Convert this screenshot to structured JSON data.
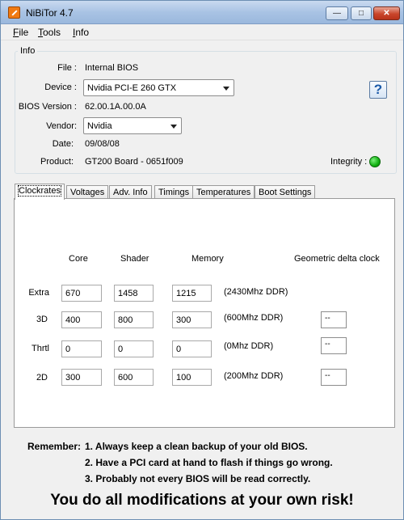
{
  "window": {
    "title": "NiBiTor 4.7"
  },
  "menu": {
    "file": {
      "first": "F",
      "rest": "ile"
    },
    "tools": {
      "first": "T",
      "rest": "ools"
    },
    "info": {
      "first": "I",
      "rest": "nfo"
    }
  },
  "info_group": {
    "title": "Info",
    "file_label": "File :",
    "file_value": "Internal BIOS",
    "device_label": "Device :",
    "device_value": "Nvidia PCI-E 260 GTX",
    "bios_version_label": "BIOS Version :",
    "bios_version_value": "62.00.1A.00.0A",
    "vendor_label": "Vendor:",
    "vendor_value": "Nvidia",
    "date_label": "Date:",
    "date_value": "09/08/08",
    "product_label": "Product:",
    "product_value": "GT200 Board - 0651f009",
    "integrity_label": "Integrity :",
    "integrity_status": "ok",
    "help_glyph": "?"
  },
  "tabs": [
    "Clockrates",
    "Voltages",
    "Adv. Info",
    "Timings",
    "Temperatures",
    "Boot Settings"
  ],
  "clockrates": {
    "headers": {
      "core": "Core",
      "shader": "Shader",
      "memory": "Memory",
      "delta": "Geometric delta clock"
    },
    "rows": [
      {
        "label": "Extra",
        "core": "670",
        "shader": "1458",
        "memory": "1215",
        "ddr": "(2430Mhz DDR)"
      },
      {
        "label": "3D",
        "core": "400",
        "shader": "800",
        "memory": "300",
        "ddr": "(600Mhz DDR)",
        "delta": "--"
      },
      {
        "label": "Thrtl",
        "core": "0",
        "shader": "0",
        "memory": "0",
        "ddr": "(0Mhz DDR)",
        "delta": "--"
      },
      {
        "label": "2D",
        "core": "300",
        "shader": "600",
        "memory": "100",
        "ddr": "(200Mhz DDR)",
        "delta": "--"
      }
    ]
  },
  "remember": {
    "label": "Remember:",
    "items": [
      "1. Always keep a clean backup of your old BIOS.",
      "2. Have a PCI card at hand to flash if things go wrong.",
      "3. Probably not every BIOS will be read correctly."
    ]
  },
  "warning": "You do all modifications at your own risk!",
  "colors": {
    "integrity_ok": "#10b010",
    "app_icon": "#f07a12",
    "help_icon": "#1b5aa8"
  },
  "icons": {
    "app": "nibitor-app-icon",
    "help": "help-icon",
    "integrity": "status-led-icon"
  }
}
